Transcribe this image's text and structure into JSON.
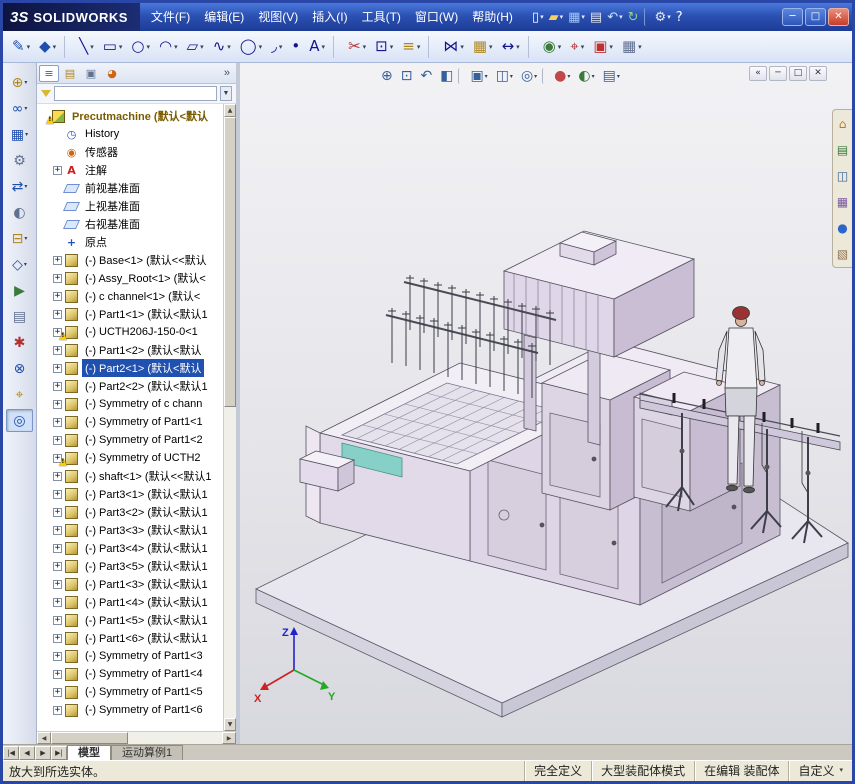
{
  "colors": {
    "titlebar_blue": "#2b51b4",
    "selection_blue": "#2050b0",
    "warning_yellow": "#ffcc00",
    "model_lavender": "#ded5e6",
    "viewport_gray": "#e8e8ec",
    "statusbar_tan": "#ece9d8"
  },
  "titlebar": {
    "logo_mark": "3S",
    "logo_name": "SOLIDWORKS",
    "menus": [
      {
        "name": "file",
        "label": "文件(F)"
      },
      {
        "name": "edit",
        "label": "编辑(E)"
      },
      {
        "name": "view",
        "label": "视图(V)"
      },
      {
        "name": "insert",
        "label": "插入(I)"
      },
      {
        "name": "tools",
        "label": "工具(T)"
      },
      {
        "name": "window",
        "label": "窗口(W)"
      },
      {
        "name": "help",
        "label": "帮助(H)"
      }
    ],
    "tools": [
      {
        "name": "new",
        "glyph": "▯",
        "color": "#ffffff",
        "dd": 1
      },
      {
        "name": "open",
        "glyph": "▰",
        "color": "#f8d060",
        "dd": 1
      },
      {
        "name": "save",
        "glyph": "▦",
        "color": "#9fc6ff",
        "dd": 1
      },
      {
        "name": "print",
        "glyph": "▤",
        "color": "#e0e6f2"
      },
      {
        "name": "undo",
        "glyph": "↶",
        "color": "#cfe0ff",
        "dd": 1
      },
      {
        "name": "rebuild",
        "glyph": "↻",
        "color": "#8fd08f"
      },
      {
        "sep": 1
      },
      {
        "name": "options",
        "glyph": "⚙",
        "color": "#e8e8e8",
        "dd": 1
      },
      {
        "name": "help",
        "glyph": "?",
        "color": "#ffffff"
      }
    ],
    "window_controls": [
      {
        "name": "minimize",
        "glyph": "─"
      },
      {
        "name": "maximize",
        "glyph": "□"
      },
      {
        "name": "close",
        "glyph": "✕",
        "close": 1
      }
    ]
  },
  "toolbar_sketch": {
    "items": [
      {
        "name": "sketch",
        "glyph": "✎",
        "color": "#1f4fae",
        "dd": 1
      },
      {
        "name": "smart-dimension",
        "glyph": "◆",
        "color": "#1f4fae",
        "dd": 1
      },
      {
        "sep": 1
      },
      {
        "name": "line",
        "glyph": "╲",
        "color": "#14148c",
        "dd": 1
      },
      {
        "name": "corner-rectangle",
        "glyph": "▭",
        "color": "#14148c",
        "dd": 1
      },
      {
        "name": "circle",
        "glyph": "○",
        "color": "#14148c",
        "dd": 1
      },
      {
        "name": "arc",
        "glyph": "◠",
        "color": "#14148c",
        "dd": 1
      },
      {
        "name": "polygon",
        "glyph": "▱",
        "color": "#14148c",
        "dd": 1
      },
      {
        "name": "spline",
        "glyph": "∿",
        "color": "#14148c",
        "dd": 1
      },
      {
        "name": "ellipse",
        "glyph": "◯",
        "color": "#14148c",
        "dd": 1
      },
      {
        "name": "sketch-fillet",
        "glyph": "◞",
        "color": "#14148c",
        "dd": 1
      },
      {
        "name": "point",
        "glyph": "•",
        "color": "#14148c"
      },
      {
        "name": "text",
        "glyph": "A",
        "color": "#14148c",
        "dd": 1
      },
      {
        "sep": 1
      },
      {
        "name": "trim-entities",
        "glyph": "✂",
        "color": "#b03030",
        "dd": 1
      },
      {
        "name": "convert-entities",
        "glyph": "⊡",
        "color": "#14148c",
        "dd": 1
      },
      {
        "name": "offset-entities",
        "glyph": "≡",
        "color": "#b08820",
        "dd": 1
      },
      {
        "sep": 1
      },
      {
        "name": "mirror-entities",
        "glyph": "⋈",
        "color": "#14148c",
        "dd": 1
      },
      {
        "name": "linear-sketch-pattern",
        "glyph": "▦",
        "color": "#b08820",
        "dd": 1
      },
      {
        "name": "move-entities",
        "glyph": "↔",
        "color": "#14148c",
        "dd": 1
      },
      {
        "sep": 1
      },
      {
        "name": "display-relations",
        "glyph": "◉",
        "color": "#3a7a3a",
        "dd": 1
      },
      {
        "name": "quick-snaps",
        "glyph": "⌖",
        "color": "#b03030",
        "dd": 1
      },
      {
        "name": "rapid-sketch",
        "glyph": "▣",
        "color": "#c03030",
        "dd": 1
      },
      {
        "name": "grid-system",
        "glyph": "▦",
        "color": "#607090",
        "dd": 1
      }
    ]
  },
  "leftstrip": {
    "items": [
      {
        "name": "insert-components",
        "glyph": "⊕",
        "color": "#b08820",
        "dd": 1
      },
      {
        "name": "mate",
        "glyph": "∞",
        "color": "#1f4fae",
        "dd": 1
      },
      {
        "name": "component-pattern",
        "glyph": "▦",
        "color": "#1f4fae",
        "dd": 1
      },
      {
        "name": "smart-fasteners",
        "glyph": "⚙",
        "color": "#607090"
      },
      {
        "name": "move-component",
        "glyph": "⇄",
        "color": "#1f4fae",
        "dd": 1
      },
      {
        "name": "show-hidden-components",
        "glyph": "◐",
        "color": "#607090"
      },
      {
        "name": "assembly-features",
        "glyph": "⊟",
        "color": "#b08820",
        "dd": 1
      },
      {
        "name": "reference-geometry",
        "glyph": "◇",
        "color": "#1f4fae",
        "dd": 1
      },
      {
        "name": "new-motion-study",
        "glyph": "▶",
        "color": "#3a7a3a"
      },
      {
        "name": "bill-of-materials",
        "glyph": "▤",
        "color": "#607090"
      },
      {
        "name": "exploded-view",
        "glyph": "✱",
        "color": "#b03030"
      },
      {
        "name": "interference-detection",
        "glyph": "⊗",
        "color": "#1f4fae"
      },
      {
        "name": "measure",
        "glyph": "⌖",
        "color": "#b08820"
      },
      {
        "name": "zoom-to-selection",
        "glyph": "◎",
        "color": "#1f4fae",
        "pressed": 1
      }
    ]
  },
  "panel": {
    "tabs": [
      {
        "name": "featuremanager-tree",
        "glyph": "≡",
        "color": "#2a7a3a",
        "active": 1
      },
      {
        "name": "propertymanager",
        "glyph": "▤",
        "color": "#b08820"
      },
      {
        "name": "configurationmanager",
        "glyph": "▣",
        "color": "#607090"
      },
      {
        "name": "displaymanager",
        "glyph": "◕",
        "color": "#cc6610"
      }
    ],
    "overflow_chevron": "»",
    "filter": {
      "value": "",
      "placeholder": ""
    }
  },
  "tree": {
    "root_text": "Precutmachine (默认<默认",
    "items": [
      {
        "name": "history",
        "icon": "history",
        "text": "History"
      },
      {
        "name": "sensors",
        "icon": "sensors",
        "text": "传感器"
      },
      {
        "name": "annotations",
        "icon": "annot",
        "exp": 1,
        "text": "注解"
      },
      {
        "name": "front-plane",
        "icon": "plane",
        "text": "前视基准面"
      },
      {
        "name": "top-plane",
        "icon": "plane",
        "text": "上视基准面"
      },
      {
        "name": "right-plane",
        "icon": "plane",
        "text": "右视基准面"
      },
      {
        "name": "origin",
        "icon": "origin",
        "text": "原点"
      },
      {
        "name": "base-1",
        "icon": "part",
        "exp": 1,
        "text": "(-) Base<1> (默认<<默认"
      },
      {
        "name": "assy-root-1",
        "icon": "part",
        "exp": 1,
        "text": "(-) Assy_Root<1> (默认<"
      },
      {
        "name": "c-channel-1",
        "icon": "part",
        "exp": 1,
        "text": "(-) c channel<1> (默认<"
      },
      {
        "name": "part1-1",
        "icon": "part",
        "exp": 1,
        "text": "(-) Part1<1> (默认<默认1"
      },
      {
        "name": "ucth206j-150-0-1",
        "icon": "part",
        "exp": 1,
        "warn": 1,
        "text": "(-) UCTH206J-150-0<1"
      },
      {
        "name": "part1-2",
        "icon": "part",
        "exp": 1,
        "text": "(-) Part1<2> (默认<默认"
      },
      {
        "name": "part2-1",
        "icon": "part",
        "exp": 1,
        "sel": 1,
        "text": "(-) Part2<1> (默认<默认"
      },
      {
        "name": "part2-2",
        "icon": "part",
        "exp": 1,
        "text": "(-) Part2<2> (默认<默认1"
      },
      {
        "name": "sym-c-channel",
        "icon": "part",
        "exp": 1,
        "text": "(-) Symmetry of c chann"
      },
      {
        "name": "sym-part1-1",
        "icon": "part",
        "exp": 1,
        "text": "(-) Symmetry of Part1<1"
      },
      {
        "name": "sym-part1-2",
        "icon": "part",
        "exp": 1,
        "text": "(-) Symmetry of Part1<2"
      },
      {
        "name": "sym-ucth",
        "icon": "part",
        "exp": 1,
        "warn": 1,
        "text": "(-) Symmetry of UCTH2"
      },
      {
        "name": "shaft-1",
        "icon": "part",
        "exp": 1,
        "text": "(-) shaft<1> (默认<<默认1"
      },
      {
        "name": "part3-1",
        "icon": "part",
        "exp": 1,
        "text": "(-) Part3<1> (默认<默认1"
      },
      {
        "name": "part3-2",
        "icon": "part",
        "exp": 1,
        "text": "(-) Part3<2> (默认<默认1"
      },
      {
        "name": "part3-3",
        "icon": "part",
        "exp": 1,
        "text": "(-) Part3<3> (默认<默认1"
      },
      {
        "name": "part3-4",
        "icon": "part",
        "exp": 1,
        "text": "(-) Part3<4> (默认<默认1"
      },
      {
        "name": "part3-5",
        "icon": "part",
        "exp": 1,
        "text": "(-) Part3<5> (默认<默认1"
      },
      {
        "name": "part1-3",
        "icon": "part",
        "exp": 1,
        "text": "(-) Part1<3> (默认<默认1"
      },
      {
        "name": "part1-4",
        "icon": "part",
        "exp": 1,
        "text": "(-) Part1<4> (默认<默认1"
      },
      {
        "name": "part1-5",
        "icon": "part",
        "exp": 1,
        "text": "(-) Part1<5> (默认<默认1"
      },
      {
        "name": "part1-6",
        "icon": "part",
        "exp": 1,
        "text": "(-) Part1<6> (默认<默认1"
      },
      {
        "name": "sym-part1-3",
        "icon": "part",
        "exp": 1,
        "text": "(-) Symmetry of Part1<3"
      },
      {
        "name": "sym-part1-4",
        "icon": "part",
        "exp": 1,
        "text": "(-) Symmetry of Part1<4"
      },
      {
        "name": "sym-part1-5",
        "icon": "part",
        "exp": 1,
        "text": "(-) Symmetry of Part1<5"
      },
      {
        "name": "sym-part1-6",
        "icon": "part",
        "exp": 1,
        "text": "(-) Symmetry of Part1<6"
      }
    ]
  },
  "viewport": {
    "view_toolbar": [
      {
        "name": "zoom-to-fit",
        "glyph": "⊕",
        "color": "#35609a"
      },
      {
        "name": "zoom-to-area",
        "glyph": "⊡",
        "color": "#35609a"
      },
      {
        "name": "previous-view",
        "glyph": "↶",
        "color": "#35609a"
      },
      {
        "name": "section-view",
        "glyph": "◧",
        "color": "#35609a"
      },
      {
        "sep": 1
      },
      {
        "name": "view-orientation",
        "glyph": "▣",
        "color": "#35609a",
        "dd": 1
      },
      {
        "name": "display-style",
        "glyph": "◫",
        "color": "#35609a",
        "dd": 1
      },
      {
        "name": "hide-show-items",
        "glyph": "◎",
        "color": "#35609a",
        "dd": 1
      },
      {
        "sep": 1
      },
      {
        "name": "edit-appearance",
        "glyph": "●",
        "color": "#c04848",
        "dd": 1
      },
      {
        "name": "apply-scene",
        "glyph": "◐",
        "color": "#3a7a3a",
        "dd": 1
      },
      {
        "name": "view-settings",
        "glyph": "▤",
        "color": "#35609a",
        "dd": 1
      }
    ],
    "doc_controls": [
      {
        "name": "featuremanager-collapse",
        "glyph": "«"
      },
      {
        "name": "doc-minimize",
        "glyph": "─"
      },
      {
        "name": "doc-restore",
        "glyph": "□"
      },
      {
        "name": "doc-close",
        "glyph": "✕"
      }
    ],
    "taskpane": [
      {
        "name": "solidworks-resources",
        "glyph": "⌂",
        "color": "#c07820"
      },
      {
        "name": "design-library",
        "glyph": "▤",
        "color": "#3a7a3a"
      },
      {
        "name": "file-explorer",
        "glyph": "◫",
        "color": "#35609a"
      },
      {
        "name": "view-palette",
        "glyph": "▦",
        "color": "#7a5aa0"
      },
      {
        "name": "appearances-scenes",
        "glyph": "●",
        "color": "#2a66cc"
      },
      {
        "name": "custom-properties",
        "glyph": "▧",
        "color": "#907050"
      }
    ],
    "triad": {
      "x": "X",
      "y": "Y",
      "z": "Z"
    }
  },
  "doc_tabs": {
    "nav": [
      {
        "name": "scroll-first",
        "glyph": "|◀"
      },
      {
        "name": "scroll-prev",
        "glyph": "◀"
      },
      {
        "name": "scroll-next",
        "glyph": "▶"
      },
      {
        "name": "scroll-last",
        "glyph": "▶|"
      }
    ],
    "tabs": [
      {
        "name": "model",
        "label": "模型",
        "active": 1
      },
      {
        "name": "motion-study-1",
        "label": "运动算例1"
      }
    ]
  },
  "statusbar": {
    "message": "放大到所选实体。",
    "segments": [
      {
        "name": "define-status",
        "label": "完全定义"
      },
      {
        "name": "assembly-mode",
        "label": "大型装配体模式"
      },
      {
        "name": "editing-state",
        "label": "在编辑 装配体"
      },
      {
        "name": "units",
        "label": "自定义",
        "dd": 1
      }
    ]
  }
}
